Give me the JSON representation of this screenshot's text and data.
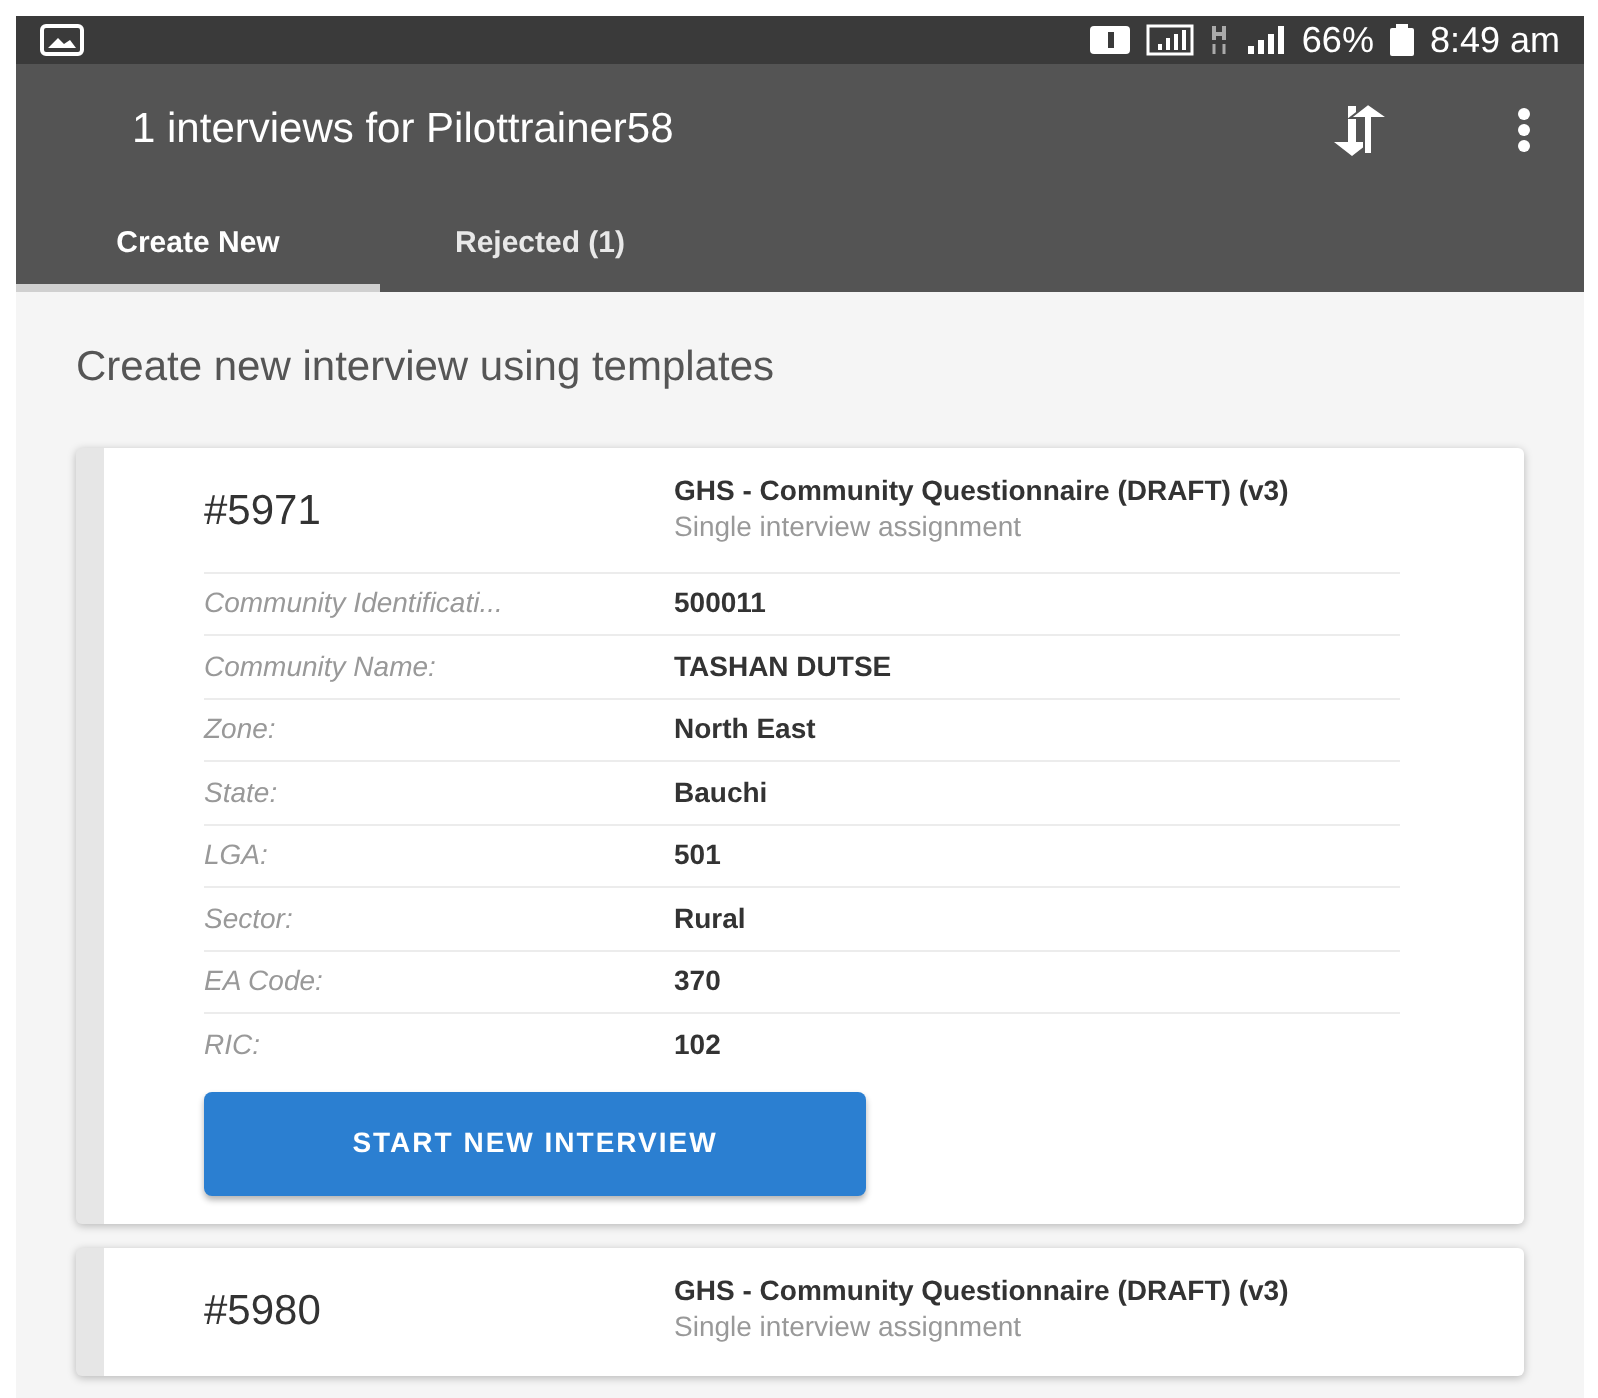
{
  "status_bar": {
    "battery": "66%",
    "time": "8:49 am"
  },
  "toolbar": {
    "title": "1 interviews for Pilottrainer58"
  },
  "tabs": [
    {
      "label": "Create New",
      "selected": true
    },
    {
      "label": "Rejected (1)",
      "selected": false
    }
  ],
  "heading": "Create new interview using templates",
  "cards": [
    {
      "number": "#5971",
      "title": "GHS - Community Questionnaire (DRAFT) (v3)",
      "subtitle": "Single interview assignment",
      "fields": [
        {
          "label": "Community Identificati...",
          "value": "500011"
        },
        {
          "label": "Community Name:",
          "value": "TASHAN DUTSE"
        },
        {
          "label": "Zone:",
          "value": "North East"
        },
        {
          "label": "State:",
          "value": "Bauchi"
        },
        {
          "label": "LGA:",
          "value": "501"
        },
        {
          "label": "Sector:",
          "value": "Rural"
        },
        {
          "label": "EA Code:",
          "value": "370"
        },
        {
          "label": "RIC:",
          "value": "102"
        }
      ],
      "button": "START NEW INTERVIEW"
    },
    {
      "number": "#5980",
      "title": "GHS - Community Questionnaire (DRAFT) (v3)",
      "subtitle": "Single interview assignment"
    }
  ]
}
